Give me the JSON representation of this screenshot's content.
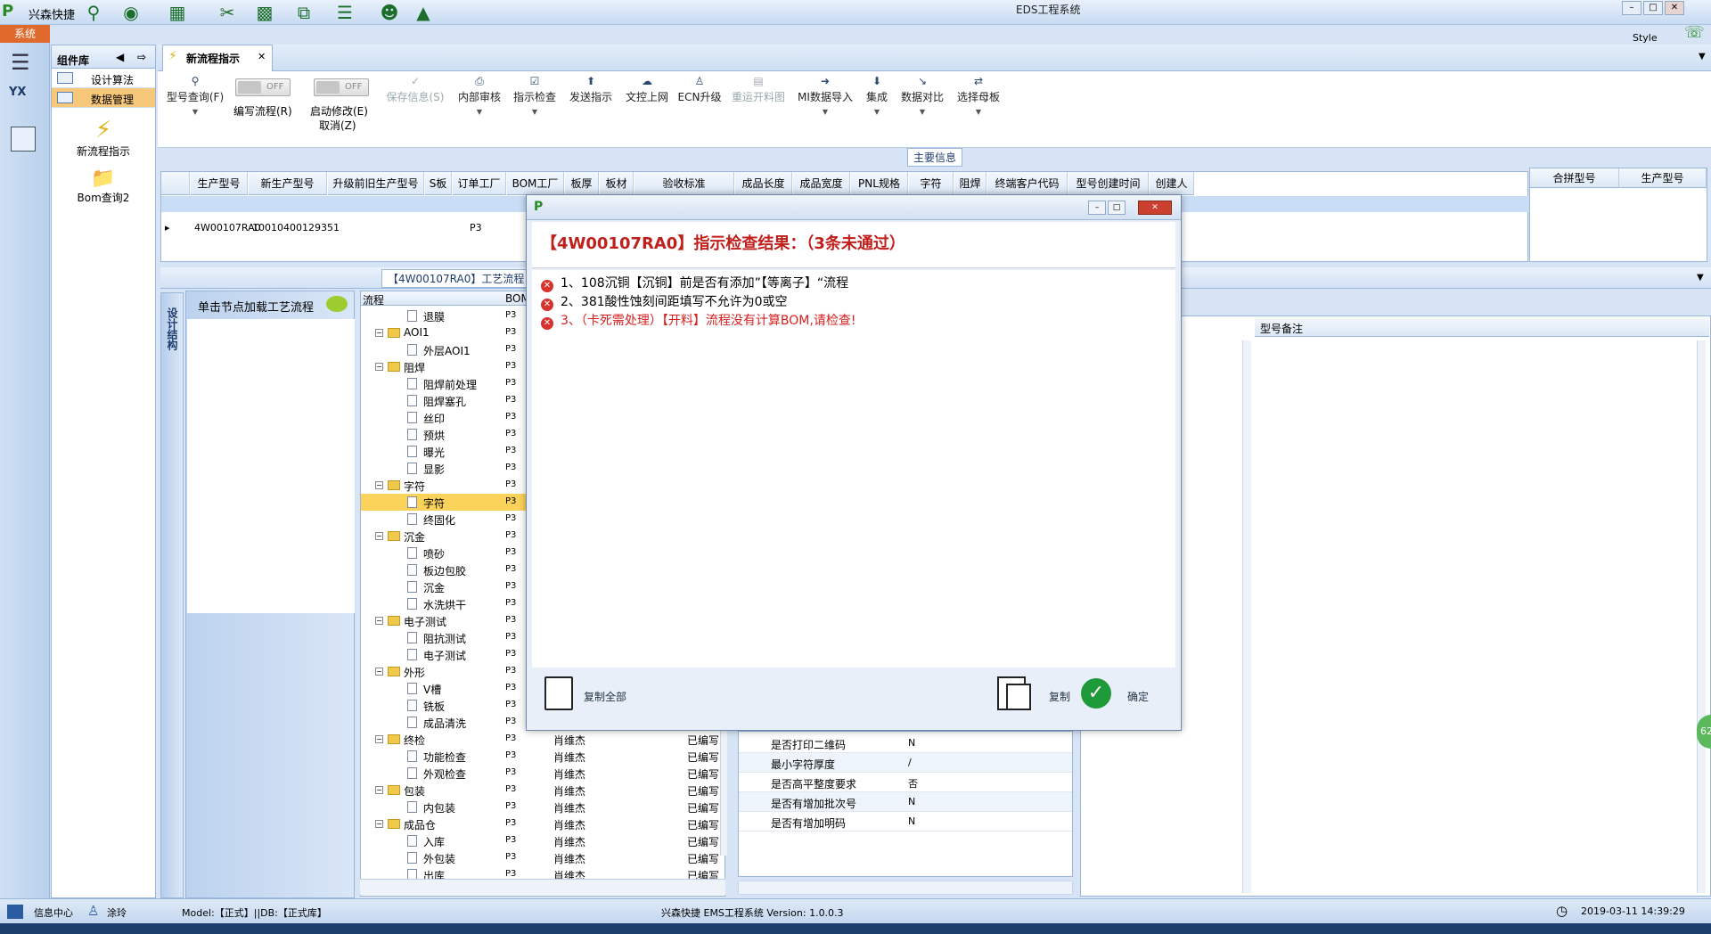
{
  "titlebar": {
    "app": "兴森快捷",
    "window_title": "EDS工程系统",
    "style_label": "Style"
  },
  "left_strip": {
    "system_label": "系统"
  },
  "component_lib": {
    "title": "组件库",
    "items": [
      {
        "label": "设计算法"
      },
      {
        "label": "数据管理"
      }
    ],
    "tiles": [
      {
        "label": "新流程指示"
      },
      {
        "label": "Bom查询2"
      }
    ]
  },
  "tab": {
    "label": "新流程指示"
  },
  "toolbar": {
    "buttons": [
      {
        "label": "型号查询(F)"
      },
      {
        "label": "编写流程(R)",
        "toggle": "OFF"
      },
      {
        "label": "启动修改(E)",
        "toggle": "OFF",
        "sub": "取消(Z)"
      },
      {
        "label": "保存信息(S)"
      },
      {
        "label": "内部审核"
      },
      {
        "label": "指示检查"
      },
      {
        "label": "发送指示"
      },
      {
        "label": "文控上网"
      },
      {
        "label": "ECN升级"
      },
      {
        "label": "重运开料图"
      },
      {
        "label": "MI数据导入"
      },
      {
        "label": "集成"
      },
      {
        "label": "数据对比"
      },
      {
        "label": "选择母板"
      }
    ]
  },
  "main_info": {
    "title": "主要信息",
    "columns": [
      "生产型号",
      "新生产型号",
      "升级前旧生产型号",
      "S板",
      "订单工厂",
      "BOM工厂",
      "板厚",
      "板材",
      "验收标准",
      "成品长度",
      "成品宽度",
      "PNL规格",
      "字符",
      "阻焊",
      "终端客户代码",
      "型号创建时间",
      "创建人"
    ],
    "row": {
      "model": "4W00107RA0",
      "new_model": "10010400129351",
      "factory": "P3"
    },
    "merge_columns": [
      "合拼型号",
      "生产型号"
    ]
  },
  "process": {
    "title": "【4W00107RA0】工艺流程",
    "vtab": "设计结构",
    "node_hint": "单击节点加载工艺流程",
    "tree_header": [
      "流程",
      "BOM"
    ],
    "rows": [
      {
        "label": "退膜",
        "level": 2,
        "code": "P3"
      },
      {
        "label": "AOI1",
        "level": 1,
        "code": "P3"
      },
      {
        "label": "外层AOI1",
        "level": 2,
        "code": "P3"
      },
      {
        "label": "阻焊",
        "level": 1,
        "code": "P3"
      },
      {
        "label": "阻焊前处理",
        "level": 2,
        "code": "P3"
      },
      {
        "label": "阻焊塞孔",
        "level": 2,
        "code": "P3"
      },
      {
        "label": "丝印",
        "level": 2,
        "code": "P3"
      },
      {
        "label": "预烘",
        "level": 2,
        "code": "P3"
      },
      {
        "label": "曝光",
        "level": 2,
        "code": "P3"
      },
      {
        "label": "显影",
        "level": 2,
        "code": "P3"
      },
      {
        "label": "字符",
        "level": 1,
        "code": "P3"
      },
      {
        "label": "字符",
        "level": 2,
        "code": "P3",
        "selected": true
      },
      {
        "label": "终固化",
        "level": 2,
        "code": "P3"
      },
      {
        "label": "沉金",
        "level": 1,
        "code": "P3"
      },
      {
        "label": "喷砂",
        "level": 2,
        "code": "P3"
      },
      {
        "label": "板边包胶",
        "level": 2,
        "code": "P3"
      },
      {
        "label": "沉金",
        "level": 2,
        "code": "P3"
      },
      {
        "label": "水洗烘干",
        "level": 2,
        "code": "P3"
      },
      {
        "label": "电子测试",
        "level": 1,
        "code": "P3"
      },
      {
        "label": "阻抗测试",
        "level": 2,
        "code": "P3"
      },
      {
        "label": "电子测试",
        "level": 2,
        "code": "P3"
      },
      {
        "label": "外形",
        "level": 1,
        "code": "P3"
      },
      {
        "label": "V槽",
        "level": 2,
        "code": "P3"
      },
      {
        "label": "铣板",
        "level": 2,
        "code": "P3"
      },
      {
        "label": "成品清洗",
        "level": 2,
        "code": "P3"
      },
      {
        "label": "终检",
        "level": 1,
        "code": "P3",
        "person": "肖维杰",
        "status": "已编写"
      },
      {
        "label": "功能检查",
        "level": 2,
        "code": "P3",
        "person": "肖维杰",
        "status": "已编写"
      },
      {
        "label": "外观检查",
        "level": 2,
        "code": "P3",
        "person": "肖维杰",
        "status": "已编写"
      },
      {
        "label": "包装",
        "level": 1,
        "code": "P3",
        "person": "肖维杰",
        "status": "已编写"
      },
      {
        "label": "内包装",
        "level": 2,
        "code": "P3",
        "person": "肖维杰",
        "status": "已编写"
      },
      {
        "label": "成品仓",
        "level": 1,
        "code": "P3",
        "person": "肖维杰",
        "status": "已编写"
      },
      {
        "label": "入库",
        "level": 2,
        "code": "P3",
        "person": "肖维杰",
        "status": "已编写"
      },
      {
        "label": "外包装",
        "level": 2,
        "code": "P3",
        "person": "肖维杰",
        "status": "已编写"
      },
      {
        "label": "出库",
        "level": 2,
        "code": "P3",
        "person": "肖维杰",
        "status": "已编写"
      }
    ]
  },
  "properties": [
    {
      "k": "是否打印二维码",
      "v": "N"
    },
    {
      "k": "最小字符厚度",
      "v": "/"
    },
    {
      "k": "是否高平整度要求",
      "v": "否"
    },
    {
      "k": "是否有增加批次号",
      "v": "N"
    },
    {
      "k": "是否有增加明码",
      "v": "N"
    }
  ],
  "right_pane": {
    "remark_header": "型号备注"
  },
  "dialog": {
    "header": "【4W00107RA0】指示检查结果：（3条未通过）",
    "messages": [
      {
        "text": "1、108沉铜【沉铜】前是否有添加”【等离子】“流程",
        "red": false
      },
      {
        "text": "2、381酸性蚀刻间距填写不允许为0或空",
        "red": false
      },
      {
        "text": "3、（卡死需处理）【开料】流程没有计算BOM,请检查!",
        "red": true
      }
    ],
    "copy_all": "复制全部",
    "copy": "复制",
    "ok": "确定"
  },
  "statusbar": {
    "info_center": "信息中心",
    "user": "涂玲",
    "model_db": "Model:【正式】||DB:【正式库】",
    "version": "兴森快捷 EMS工程系统 Version: 1.0.0.3",
    "datetime": "2019-03-11 14:39:29"
  }
}
